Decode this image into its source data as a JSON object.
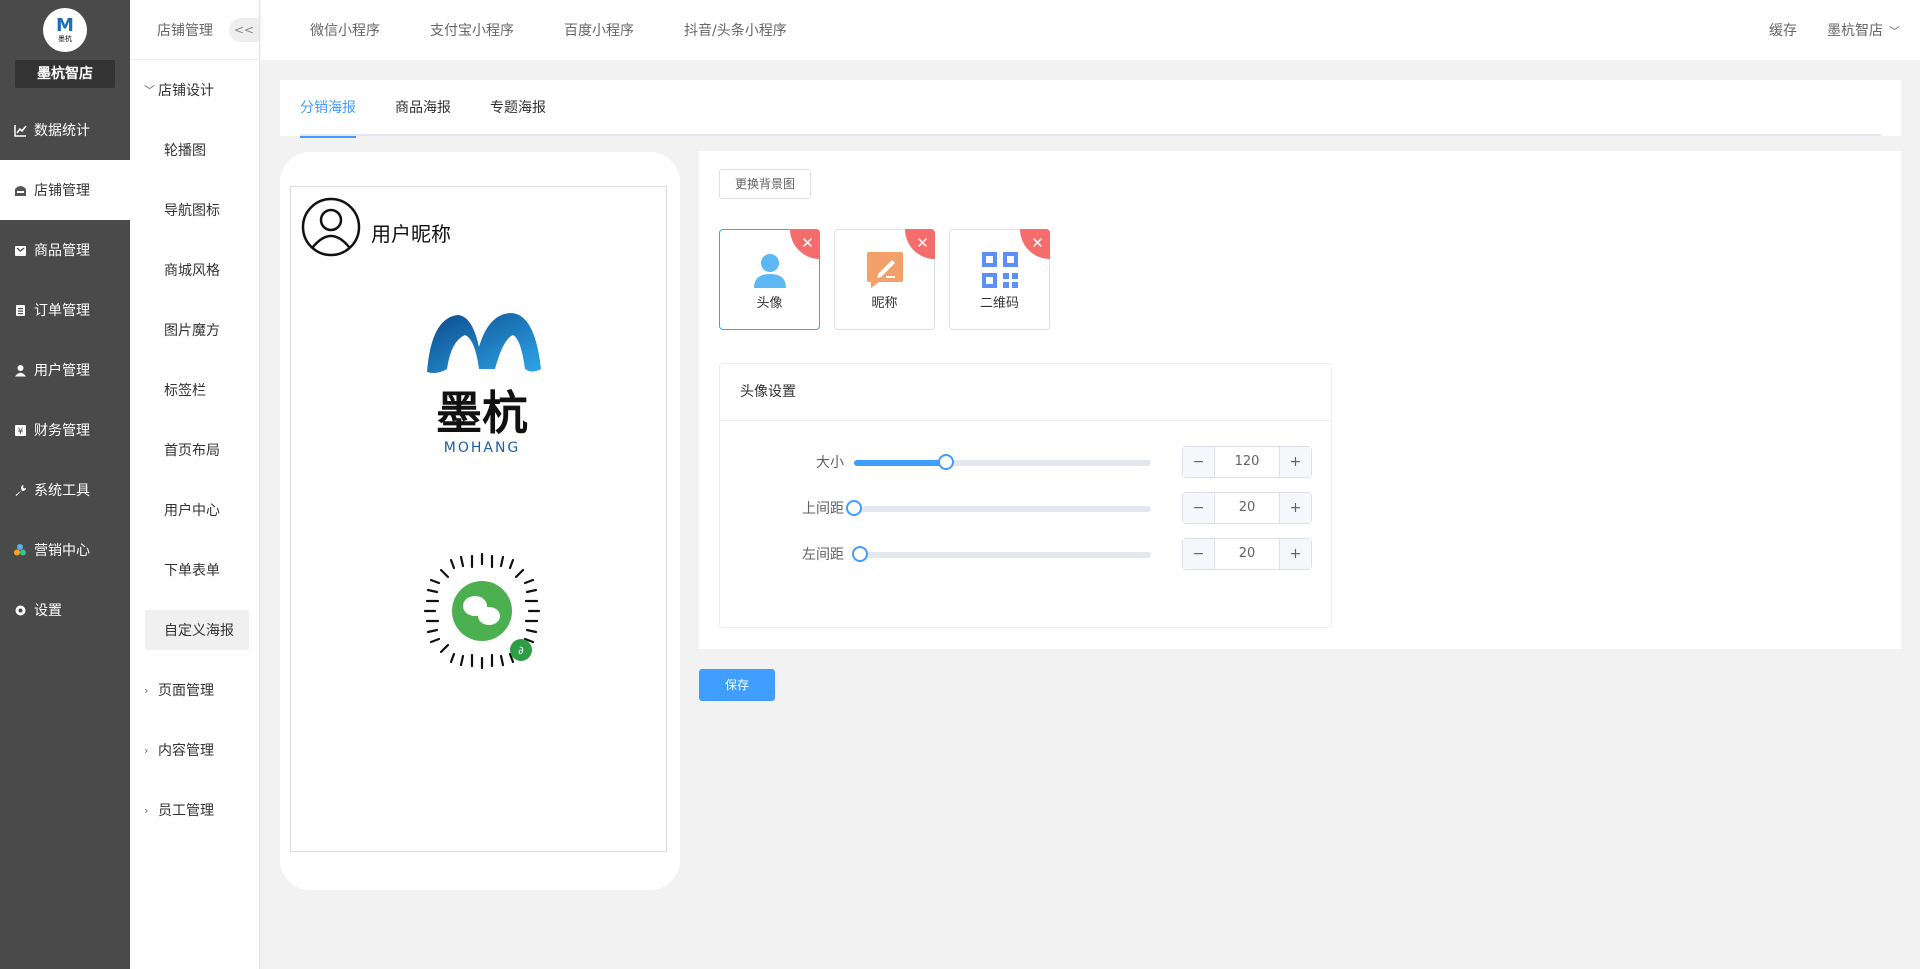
{
  "sidebar": {
    "logo_letter": "M",
    "logo_text": "墨杭",
    "store_name": "墨杭智店",
    "items": [
      {
        "label": "数据统计",
        "icon": "chart-icon"
      },
      {
        "label": "店铺管理",
        "icon": "store-icon"
      },
      {
        "label": "商品管理",
        "icon": "goods-icon"
      },
      {
        "label": "订单管理",
        "icon": "order-icon"
      },
      {
        "label": "用户管理",
        "icon": "user-icon"
      },
      {
        "label": "财务管理",
        "icon": "finance-icon"
      },
      {
        "label": "系统工具",
        "icon": "wrench-icon"
      },
      {
        "label": "营销中心",
        "icon": "marketing-icon"
      },
      {
        "label": "设置",
        "icon": "gear-icon"
      }
    ],
    "active_index": 1
  },
  "subsidebar": {
    "title": "店铺管理",
    "collapse_label": "<<",
    "group_design": "店铺设计",
    "design_items": [
      "轮播图",
      "导航图标",
      "商城风格",
      "图片魔方",
      "标签栏",
      "首页布局",
      "用户中心",
      "下单表单",
      "自定义海报"
    ],
    "group_page": "页面管理",
    "group_content": "内容管理",
    "group_staff": "员工管理"
  },
  "topbar": {
    "tabs": [
      "微信小程序",
      "支付宝小程序",
      "百度小程序",
      "抖音/头条小程序"
    ],
    "cache": "缓存",
    "user": "墨杭智店"
  },
  "poster_tabs": {
    "items": [
      "分销海报",
      "商品海报",
      "专题海报"
    ],
    "active_index": 0
  },
  "preview": {
    "nickname": "用户昵称",
    "brand_cn": "墨杭",
    "brand_en": "MOHANG"
  },
  "editor": {
    "change_bg_button": "更换背景图",
    "elements": [
      {
        "label": "头像",
        "icon": "avatar-icon"
      },
      {
        "label": "昵称",
        "icon": "nickname-icon"
      },
      {
        "label": "二维码",
        "icon": "qrcode-icon"
      }
    ],
    "delete_glyph": "✕",
    "settings_title": "头像设置",
    "rows": [
      {
        "label": "大小",
        "value": "120",
        "fraction": 0.31
      },
      {
        "label": "上间距",
        "value": "20",
        "fraction": 0.0
      },
      {
        "label": "左间距",
        "value": "20",
        "fraction": 0.02
      }
    ],
    "minus": "−",
    "plus": "+",
    "save_button": "保存"
  },
  "colors": {
    "primary": "#409eff",
    "danger": "#f56c6c",
    "sidebar_bg": "#4a4a4a"
  }
}
